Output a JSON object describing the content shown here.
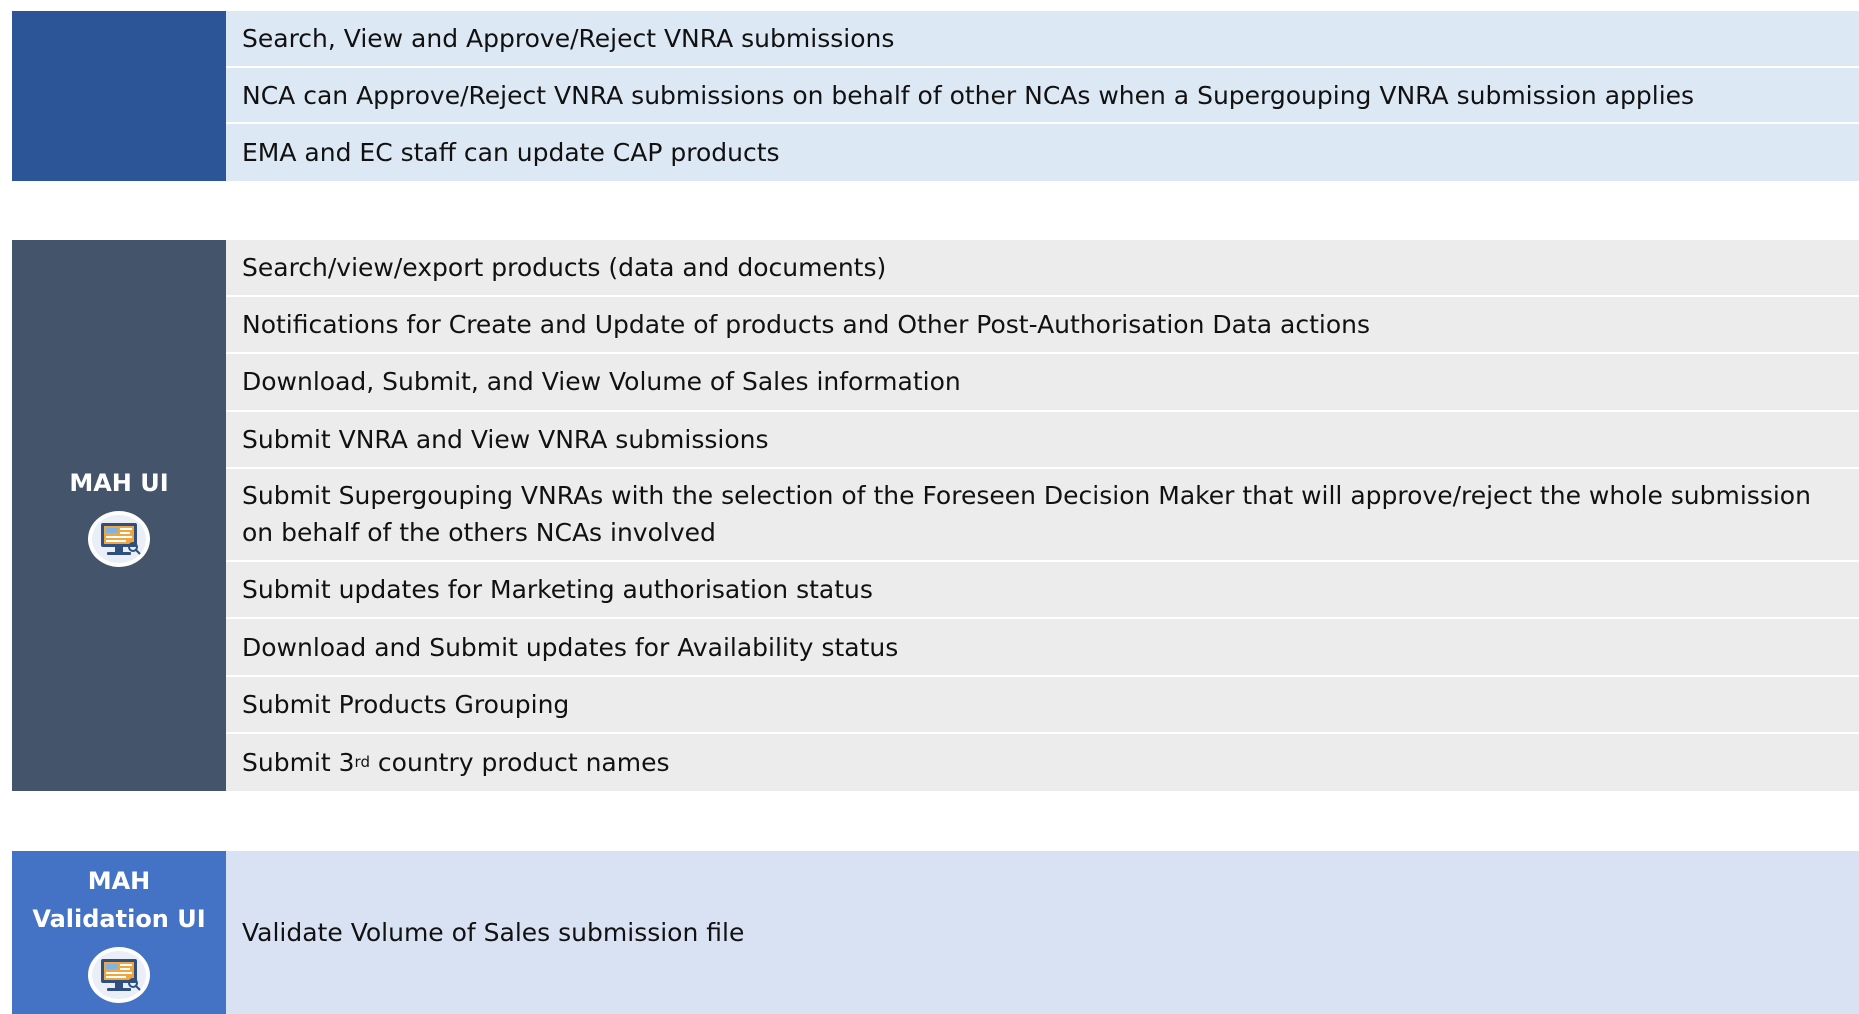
{
  "sections": [
    {
      "label": "",
      "rows": [
        "Search, View and Approve/Reject VNRA submissions",
        "NCA can Approve/Reject VNRA submissions on behalf of other NCAs when a Supergouping VNRA submission applies",
        "EMA and EC staff can update CAP products"
      ]
    },
    {
      "label": "MAH UI",
      "icon": "computer-screen-icon",
      "rows": [
        "Search/view/export products (data and documents)",
        "Notifications for Create and Update of products and Other Post-Authorisation Data actions",
        "Download, Submit, and View Volume of Sales information",
        "Submit VNRA and View VNRA submissions",
        "Submit Supergouping VNRAs with the selection of the Foreseen Decision Maker that will approve/reject the whole submission on behalf of the others NCAs involved",
        "Submit updates for Marketing authorisation status",
        "Download and Submit updates for Availability status",
        "Submit Products Grouping"
      ],
      "last_row": {
        "prefix": "Submit 3",
        "superscript": "rd",
        "suffix": " country product names"
      }
    },
    {
      "label_line1": "MAH",
      "label_line2": "Validation UI",
      "icon": "computer-screen-icon",
      "rows": [
        "Validate Volume of Sales submission file"
      ]
    }
  ],
  "colors": {
    "section1_label_bg": "#2b5597",
    "section1_row_bg": "#dde8f5",
    "section2_label_bg": "#44546a",
    "section2_row_bg": "#ececec",
    "section3_label_bg": "#4472c4",
    "section3_row_bg": "#d9e2f3"
  }
}
